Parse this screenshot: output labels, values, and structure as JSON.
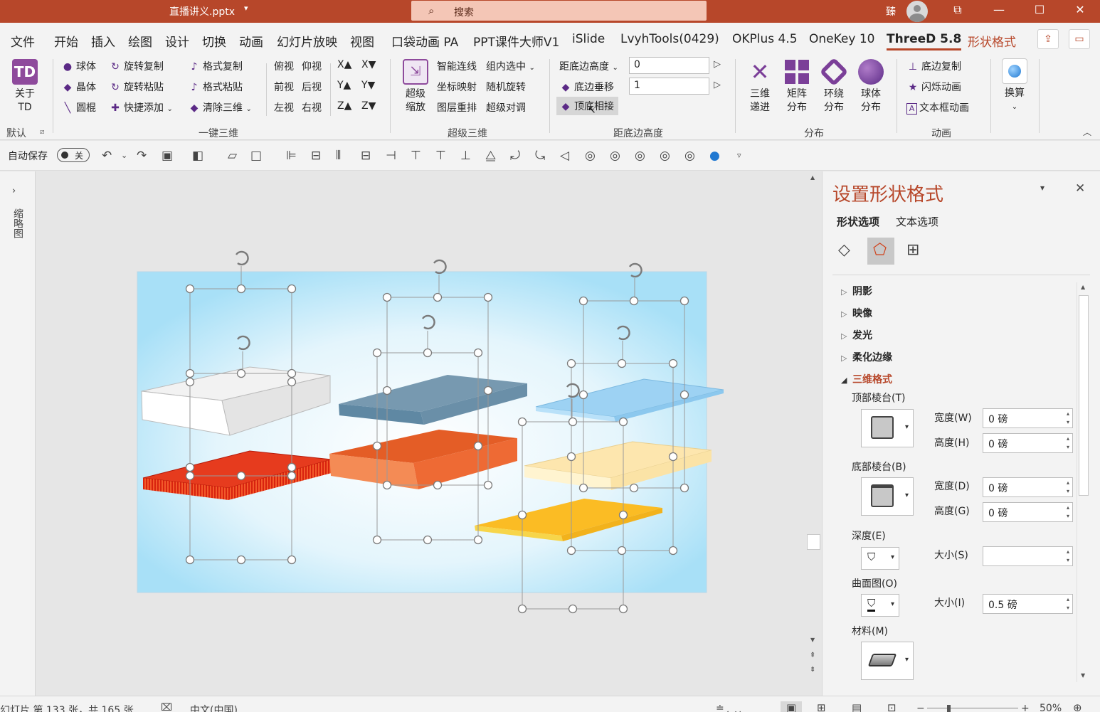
{
  "titlebar": {
    "filename": "直播讲义.pptx",
    "search_placeholder": "搜索",
    "user_name": "臻"
  },
  "menu_tabs": [
    "文件",
    "开始",
    "插入",
    "绘图",
    "设计",
    "切换",
    "动画",
    "幻灯片放映",
    "视图",
    "口袋动画 PA",
    "PPT课件大师V1",
    "iSlide",
    "LvyhTools(0429)",
    "OKPlus 4.5",
    "OneKey 10",
    "ThreeD 5.8",
    "形状格式"
  ],
  "ribbon": {
    "about": {
      "line1": "关于",
      "line2": "TD"
    },
    "default_label": "默认",
    "yijian": {
      "col1": [
        "球体",
        "晶体",
        "圆棍"
      ],
      "col2": [
        "旋转复制",
        "旋转粘贴",
        "快捷添加"
      ],
      "col3": [
        "格式复制",
        "格式粘贴",
        "清除三维"
      ],
      "views": [
        "俯视",
        "仰视",
        "前视",
        "后视",
        "左视",
        "右视"
      ],
      "axes": [
        "X▲",
        "X▼",
        "Y▲",
        "Y▼",
        "Z▲",
        "Z▼"
      ],
      "group_label": "一键三维"
    },
    "chaoji": {
      "big": {
        "line1": "超级",
        "line2": "缩放"
      },
      "items": [
        "智能连线",
        "组内选中",
        "坐标映射",
        "随机旋转",
        "图层重排",
        "超级对调"
      ],
      "group_label": "超级三维"
    },
    "juli": {
      "dropdown": "距底边高度",
      "value1": "0",
      "row2": "底边垂移",
      "value2": "1",
      "row3": "顶底相接",
      "group_label": "距底边高度"
    },
    "fenbu": {
      "buttons": [
        {
          "line1": "三维",
          "line2": "递进"
        },
        {
          "line1": "矩阵",
          "line2": "分布"
        },
        {
          "line1": "环绕",
          "line2": "分布"
        },
        {
          "line1": "球体",
          "line2": "分布"
        }
      ],
      "group_label": "分布"
    },
    "donghua": {
      "items": [
        "底边复制",
        "闪烁动画",
        "文本框动画"
      ],
      "group_label": "动画"
    },
    "huansuan": "换算"
  },
  "qat": {
    "autosave": "自动保存",
    "toggle": "关"
  },
  "leftpane": {
    "thumb_label": "缩略图"
  },
  "panel": {
    "title": "设置形状格式",
    "tabs": [
      "形状选项",
      "文本选项"
    ],
    "sections": [
      "阴影",
      "映像",
      "发光",
      "柔化边缘",
      "三维格式"
    ],
    "top_bevel": "顶部棱台(T)",
    "bottom_bevel": "底部棱台(B)",
    "width_top": {
      "label": "宽度(W)",
      "value": "0 磅"
    },
    "height_top": {
      "label": "高度(H)",
      "value": "0 磅"
    },
    "width_bottom": {
      "label": "宽度(D)",
      "value": "0 磅"
    },
    "height_bottom": {
      "label": "高度(G)",
      "value": "0 磅"
    },
    "depth": "深度(E)",
    "depth_size": {
      "label": "大小(S)",
      "value": ""
    },
    "contour": "曲面图(O)",
    "contour_size": {
      "label": "大小(I)",
      "value": "0.5 磅"
    },
    "material": "材料(M)"
  },
  "status": {
    "slide_info": "幻灯片 第 133 张，共 165 张",
    "language": "中文(中国)",
    "notes": "备注",
    "zoom": "50%"
  },
  "colors": {
    "accent": "#b7472a",
    "panel_title": "#b7472a"
  }
}
